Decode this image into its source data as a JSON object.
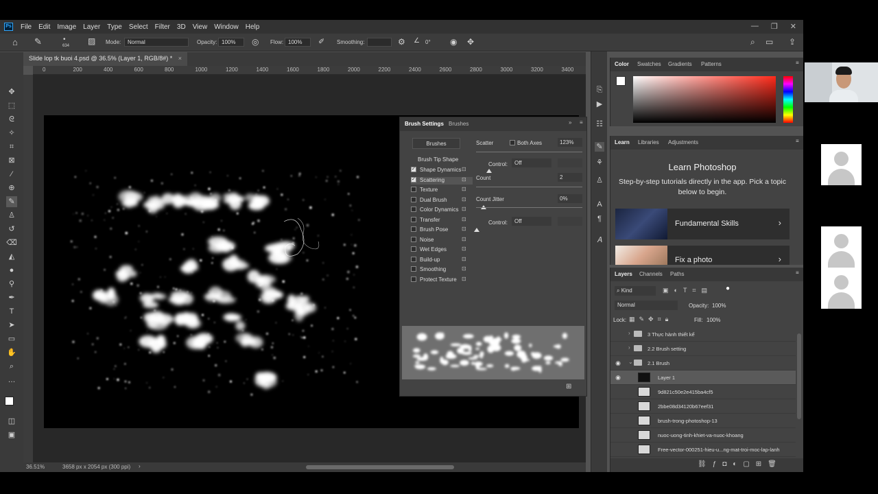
{
  "menubar": {
    "items": [
      "File",
      "Edit",
      "Image",
      "Layer",
      "Type",
      "Select",
      "Filter",
      "3D",
      "View",
      "Window",
      "Help"
    ]
  },
  "options_bar": {
    "brush_size": "634",
    "mode_label": "Mode:",
    "mode_value": "Normal",
    "opacity_label": "Opacity:",
    "opacity_value": "100%",
    "flow_label": "Flow:",
    "flow_value": "100%",
    "smoothing_label": "Smoothing:",
    "angle_value": "0°"
  },
  "document": {
    "tab_title": "Slide lop tk buoi 4.psd @ 36.5% (Layer 1, RGB/8#) *",
    "ruler_ticks": [
      "0",
      "200",
      "400",
      "600",
      "800",
      "1000",
      "1200",
      "1400",
      "1600",
      "1800",
      "2000",
      "2200",
      "2400",
      "2600",
      "2800",
      "3000",
      "3200",
      "3400"
    ],
    "zoom": "36.51%",
    "doc_info": "3658 px x 2054 px (300 ppi)"
  },
  "brush_settings": {
    "tab_active": "Brush Settings",
    "tab_other": "Brushes",
    "brushes_button": "Brushes",
    "tip_shape": "Brush Tip Shape",
    "items": [
      {
        "label": "Shape Dynamics",
        "checked": true
      },
      {
        "label": "Scattering",
        "checked": true
      },
      {
        "label": "Texture",
        "checked": false
      },
      {
        "label": "Dual Brush",
        "checked": false
      },
      {
        "label": "Color Dynamics",
        "checked": false
      },
      {
        "label": "Transfer",
        "checked": false
      },
      {
        "label": "Brush Pose",
        "checked": false
      },
      {
        "label": "Noise",
        "checked": false
      },
      {
        "label": "Wet Edges",
        "checked": false
      },
      {
        "label": "Build-up",
        "checked": false
      },
      {
        "label": "Smoothing",
        "checked": false
      },
      {
        "label": "Protect Texture",
        "checked": false
      }
    ],
    "scatter_label": "Scatter",
    "both_axes_label": "Both Axes",
    "scatter_value": "123%",
    "control_label": "Control:",
    "control_value": "Off",
    "count_label": "Count",
    "count_value": "2",
    "count_jitter_label": "Count Jitter",
    "count_jitter_value": "0%",
    "control2_label": "Control:",
    "control2_value": "Off"
  },
  "color_panel": {
    "tabs": [
      "Color",
      "Swatches",
      "Gradients",
      "Patterns"
    ],
    "hue_color": "#ff2a1a"
  },
  "learn_panel": {
    "tabs": [
      "Learn",
      "Libraries",
      "Adjustments"
    ],
    "heading": "Learn Photoshop",
    "description": "Step-by-step tutorials directly in the app. Pick a topic below to begin.",
    "cards": [
      "Fundamental Skills",
      "Fix a photo"
    ]
  },
  "layers_panel": {
    "tabs": [
      "Layers",
      "Channels",
      "Paths"
    ],
    "kind_label": "Kind",
    "blend_mode": "Normal",
    "opacity_label": "Opacity:",
    "opacity_value": "100%",
    "lock_label": "Lock:",
    "fill_label": "Fill:",
    "fill_value": "100%",
    "layers": [
      {
        "name": "3 Thực hành thiết kế",
        "type": "group"
      },
      {
        "name": "2.2 Brush setting",
        "type": "group"
      },
      {
        "name": "2.1 Brush",
        "type": "group"
      },
      {
        "name": "Layer 1",
        "type": "layer"
      },
      {
        "name": "9d821c50e2e415ba4cf5",
        "type": "smart"
      },
      {
        "name": "2bbe08d34120b67eef31",
        "type": "smart"
      },
      {
        "name": "brush-trong-photoshop-13",
        "type": "smart"
      },
      {
        "name": "nuoc-uong-tinh-khiet-va-nuoc-khoang",
        "type": "smart"
      },
      {
        "name": "Free-vector-000251-hieu-u...ng-mat-troi-moc-lap-lanh",
        "type": "smart"
      }
    ]
  }
}
